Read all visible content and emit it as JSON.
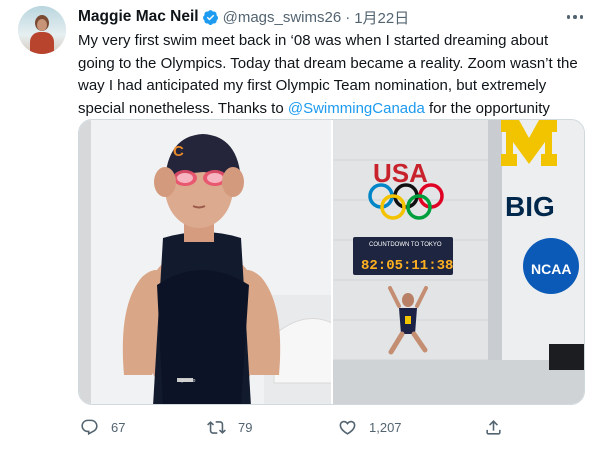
{
  "tweet": {
    "author_name": "Maggie Mac Neil",
    "handle": "@mags_swims26",
    "separator": "·",
    "date": "1月22日",
    "text_part1": "My very first swim meet back in ‘08 was when I started dreaming about going to the Olympics. Today that dream became a reality. Zoom wasn’t the way I had anticipated my first Olympic Team nomination, but extremely special nonetheless. Thanks to ",
    "mention": "@SwimmingCanada",
    "text_part2": " for the opportunity"
  },
  "media": {
    "left_photo": {
      "cap_letter": "C",
      "suit_logo": "speedo"
    },
    "right_photo": {
      "usa_text": "USA",
      "clock_label": "COUNTDOWN TO TOKYO",
      "clock_digits": "82:05:11:38",
      "wall_big_text": "BIG",
      "ncaa_text": "NCAA"
    }
  },
  "actions": {
    "reply_count": "67",
    "retweet_count": "79",
    "like_count": "1,207"
  },
  "colors": {
    "link": "#1d9bf0",
    "secondary_text": "#536471",
    "verified": "#1d9bf0",
    "michigan_maize": "#f2c400",
    "michigan_blue": "#00274c",
    "ncaa_blue": "#0b5ab8"
  },
  "icons": [
    "verified-badge-icon",
    "more-options-icon",
    "reply-icon",
    "retweet-icon",
    "like-icon",
    "share-icon"
  ]
}
